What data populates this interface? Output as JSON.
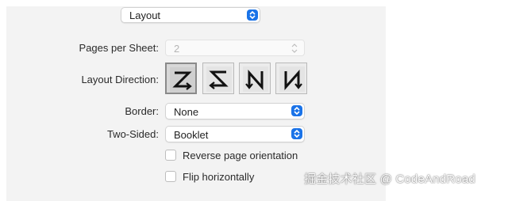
{
  "layout_menu": {
    "value": "Layout"
  },
  "pages_per_sheet": {
    "label": "Pages per Sheet:",
    "value": "2",
    "stepper_glyph": "⌃⌄"
  },
  "layout_direction": {
    "label": "Layout Direction:",
    "options": [
      {
        "name": "z-order-icon",
        "selected": true
      },
      {
        "name": "reverse-z-order-icon",
        "selected": false
      },
      {
        "name": "reverse-n-order-icon",
        "selected": false
      },
      {
        "name": "n-order-icon",
        "selected": false
      }
    ]
  },
  "border": {
    "label": "Border:",
    "value": "None"
  },
  "two_sided": {
    "label": "Two-Sided:",
    "value": "Booklet"
  },
  "checkboxes": [
    {
      "label": "Reverse page orientation",
      "checked": false
    },
    {
      "label": "Flip horizontally",
      "checked": false
    }
  ],
  "watermark": {
    "text": "掘金技术社区 @ CodeAndRoad"
  },
  "colors": {
    "accent": "#1a73e8",
    "panel": "#f3f3f3"
  }
}
